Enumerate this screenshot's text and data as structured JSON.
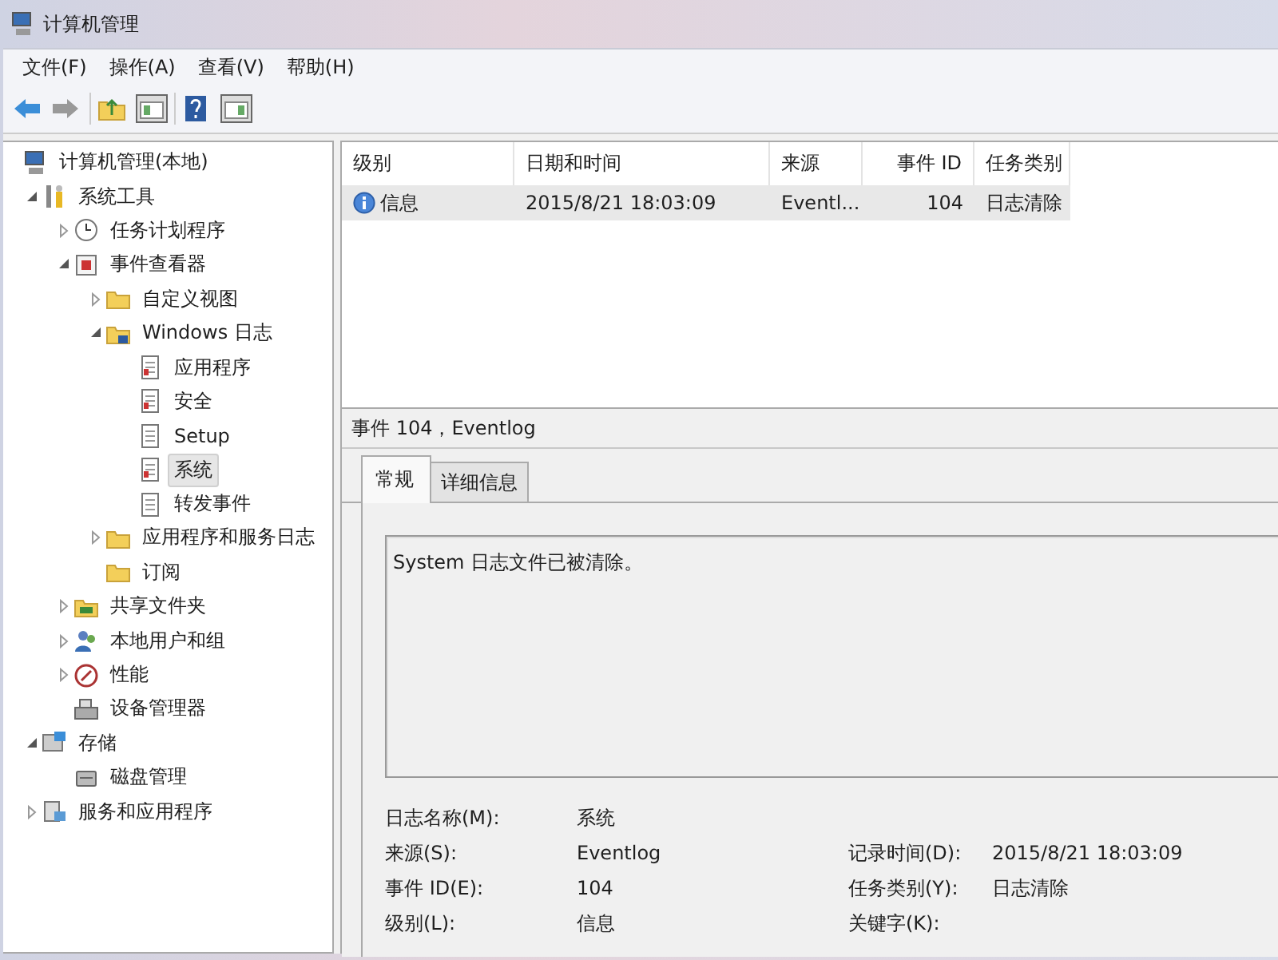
{
  "window": {
    "title": "计算机管理"
  },
  "menu": [
    "文件(F)",
    "操作(A)",
    "查看(V)",
    "帮助(H)"
  ],
  "tree": {
    "items": [
      {
        "label": "计算机管理(本地)",
        "kind": "computer",
        "selected": false,
        "children": [
          {
            "label": "系统工具",
            "kind": "tools",
            "expanded": true,
            "selected": false,
            "children": [
              {
                "label": "任务计划程序",
                "kind": "clock",
                "expanded": false,
                "selected": false
              },
              {
                "label": "事件查看器",
                "kind": "viewer",
                "expanded": true,
                "selected": false,
                "children": [
                  {
                    "label": "自定义视图",
                    "kind": "folder",
                    "expanded": false,
                    "selected": false
                  },
                  {
                    "label": "Windows 日志",
                    "kind": "logfolder",
                    "expanded": true,
                    "selected": false,
                    "children": [
                      {
                        "label": "应用程序",
                        "kind": "log",
                        "selected": false
                      },
                      {
                        "label": "安全",
                        "kind": "log",
                        "selected": false
                      },
                      {
                        "label": "Setup",
                        "kind": "plainlog",
                        "selected": false
                      },
                      {
                        "label": "系统",
                        "kind": "log",
                        "selected": true
                      },
                      {
                        "label": "转发事件",
                        "kind": "plainlog",
                        "selected": false
                      }
                    ]
                  },
                  {
                    "label": "应用程序和服务日志",
                    "kind": "folder",
                    "expanded": false,
                    "selected": false
                  },
                  {
                    "label": "订阅",
                    "kind": "folder",
                    "selected": false
                  }
                ]
              },
              {
                "label": "共享文件夹",
                "kind": "share",
                "expanded": false,
                "selected": false
              },
              {
                "label": "本地用户和组",
                "kind": "users",
                "expanded": false,
                "selected": false
              },
              {
                "label": "性能",
                "kind": "perf",
                "expanded": false,
                "selected": false
              },
              {
                "label": "设备管理器",
                "kind": "device",
                "selected": false
              }
            ]
          },
          {
            "label": "存储",
            "kind": "storage",
            "expanded": true,
            "selected": false,
            "children": [
              {
                "label": "磁盘管理",
                "kind": "disk",
                "selected": false
              }
            ]
          },
          {
            "label": "服务和应用程序",
            "kind": "services",
            "expanded": false,
            "selected": false
          }
        ]
      }
    ]
  },
  "table": {
    "columns": [
      "级别",
      "日期和时间",
      "来源",
      "事件 ID",
      "任务类别"
    ],
    "rows": [
      {
        "cells": [
          "信息",
          "2015/8/21 18:03:09",
          "Eventl...",
          "104",
          "日志清除"
        ],
        "selected": true
      }
    ]
  },
  "detail": {
    "title": "事件 104，Eventlog",
    "tabs": [
      {
        "label": "常规",
        "selected": true
      },
      {
        "label": "详细信息",
        "selected": false
      }
    ],
    "message": "System 日志文件已被清除。",
    "fields": [
      {
        "left": {
          "label": "日志名称(M):",
          "value": "系统"
        }
      },
      {
        "left": {
          "label": "来源(S):",
          "value": "Eventlog"
        },
        "right": {
          "label": "记录时间(D):",
          "value": "2015/8/21 18:03:09"
        }
      },
      {
        "left": {
          "label": "事件 ID(E):",
          "value": "104"
        },
        "right": {
          "label": "任务类别(Y):",
          "value": "日志清除"
        }
      },
      {
        "left": {
          "label": "级别(L):",
          "value": "信息"
        },
        "right": {
          "label": "关键字(K):"
        }
      }
    ]
  }
}
